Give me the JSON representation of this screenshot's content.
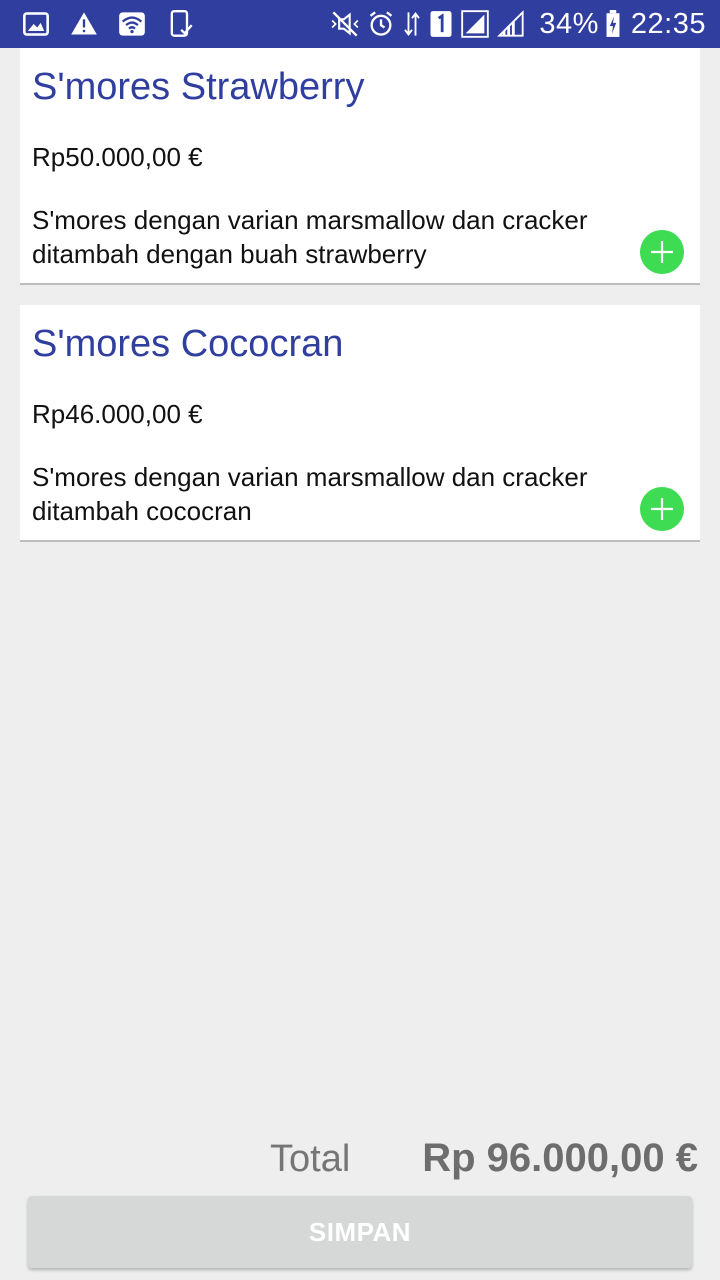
{
  "status_bar": {
    "left_icons": [
      "gallery-icon",
      "warning-icon",
      "wifi-icon",
      "phone-check-icon"
    ],
    "right_icons": [
      "mute-icon",
      "alarm-icon",
      "data-arrows-icon",
      "sim-one-icon",
      "signal-icon",
      "signal-icon"
    ],
    "battery_percent": "34%",
    "time": "22:35",
    "background_color": "#303f9f"
  },
  "products": [
    {
      "name": "S'mores Strawberry",
      "price": "Rp50.000,00 €",
      "description": "S'mores dengan varian marsmallow dan cracker ditambah dengan buah strawberry"
    },
    {
      "name": "S'mores Cococran",
      "price": "Rp46.000,00 €",
      "description": "S'mores dengan varian marsmallow dan cracker ditambah cococran"
    }
  ],
  "total": {
    "label": "Total",
    "value": "Rp 96.000,00 €"
  },
  "save_button": {
    "label": "SIMPAN"
  },
  "colors": {
    "accent": "#303f9f",
    "add_button": "#3ddc52",
    "disabled_button": "#d6d7d7"
  }
}
